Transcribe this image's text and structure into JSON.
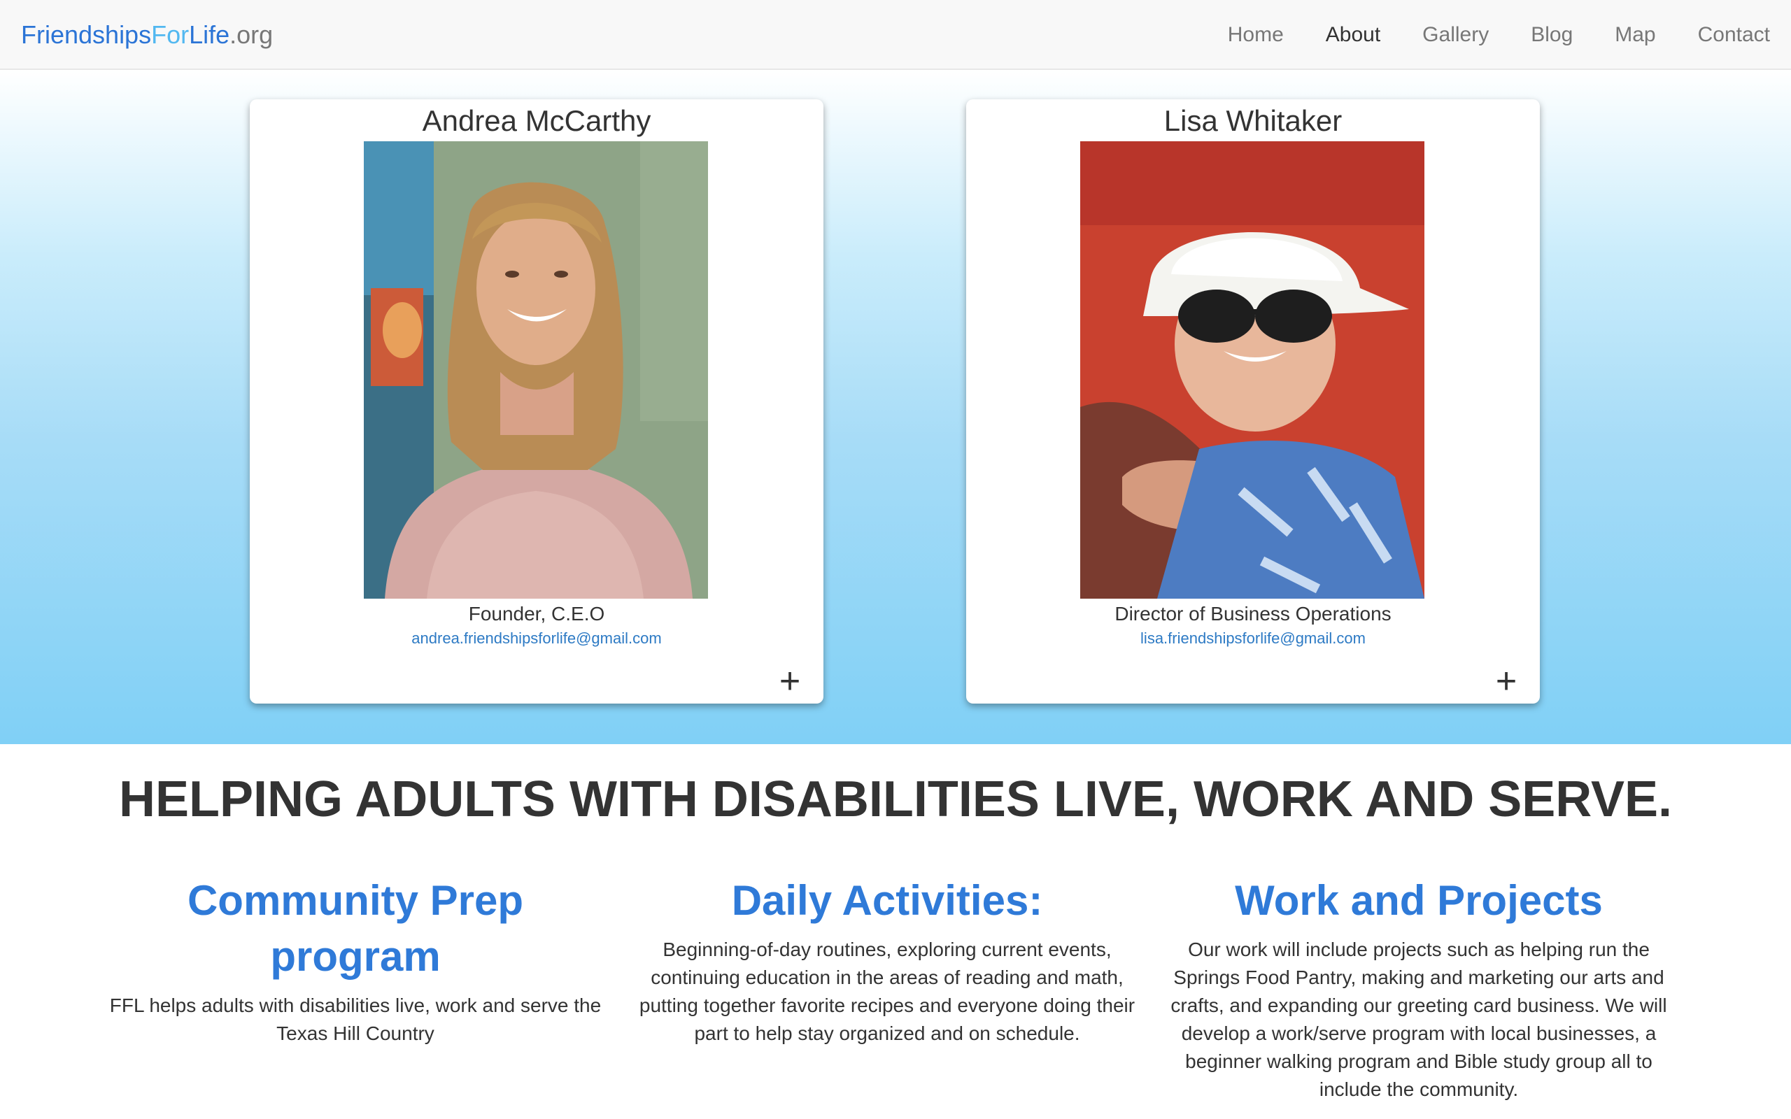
{
  "navbar": {
    "brand": {
      "part1": "Friendships",
      "part2": "For",
      "part3": "Life",
      "part4": ".org"
    },
    "items": [
      {
        "label": "Home",
        "active": false
      },
      {
        "label": "About",
        "active": true
      },
      {
        "label": "Gallery",
        "active": false
      },
      {
        "label": "Blog",
        "active": false
      },
      {
        "label": "Map",
        "active": false
      },
      {
        "label": "Contact",
        "active": false
      }
    ]
  },
  "team": [
    {
      "name": "Andrea McCarthy",
      "role": "Founder, C.E.O",
      "email": "andrea.friendshipsforlife@gmail.com",
      "expand_icon": "plus-icon",
      "expand_symbol": "+"
    },
    {
      "name": "Lisa Whitaker",
      "role": "Director of Business Operations",
      "email": "lisa.friendshipsforlife@gmail.com",
      "expand_icon": "plus-icon",
      "expand_symbol": "+"
    }
  ],
  "mission": {
    "headline": "HELPING ADULTS WITH DISABILITIES LIVE, WORK AND SERVE."
  },
  "programs": [
    {
      "title": "Community Prep program",
      "text": "FFL helps adults with disabilities live, work and serve the Texas Hill Country"
    },
    {
      "title": "Daily Activities:",
      "text": "Beginning-of-day routines, exploring current events, continuing education in the areas of reading and math, putting together favorite recipes and everyone doing their part to help stay organized and on schedule."
    },
    {
      "title": "Work and Projects",
      "text": "Our work will include projects such as helping run the Springs Food Pantry, making and marketing our arts and crafts, and expanding our greeting card business. We will develop a work/serve program with local businesses, a beginner walking program and Bible study group all to include the community."
    }
  ],
  "colors": {
    "brand_blue": "#2b74d6",
    "brand_light_blue": "#52b8f0",
    "heading_blue": "#2f7ad8",
    "link_blue": "#2d7ac4",
    "hero_gradient_bottom": "#80d0f6"
  }
}
